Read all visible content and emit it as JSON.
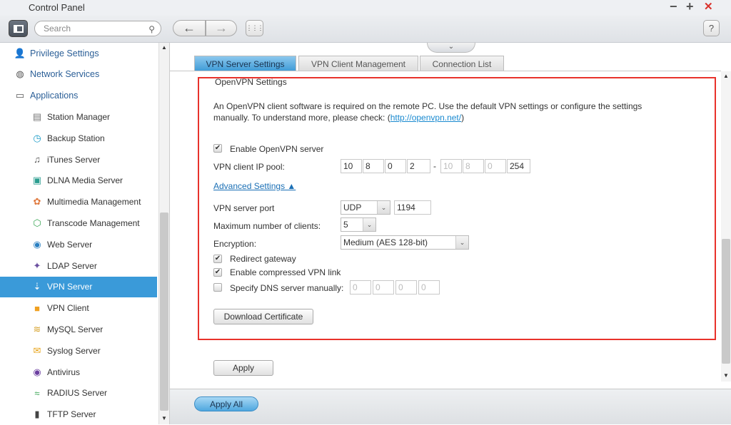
{
  "window": {
    "title": "Control Panel",
    "minimize": "−",
    "maximize": "+",
    "close": "✕"
  },
  "toolbar": {
    "search_placeholder": "Search",
    "back": "←",
    "forward": "→",
    "apps": "⋮⋮⋮",
    "help": "?"
  },
  "sidebar": {
    "items": [
      {
        "label": "Privilege Settings",
        "icon": "user-icon"
      },
      {
        "label": "Network Services",
        "icon": "globe-icon"
      },
      {
        "label": "Applications",
        "icon": "inbox-icon"
      },
      {
        "label": "Station Manager",
        "icon": "station-icon"
      },
      {
        "label": "Backup Station",
        "icon": "backup-icon"
      },
      {
        "label": "iTunes Server",
        "icon": "itunes-icon"
      },
      {
        "label": "DLNA Media Server",
        "icon": "dlna-icon"
      },
      {
        "label": "Multimedia Management",
        "icon": "multimedia-icon"
      },
      {
        "label": "Transcode Management",
        "icon": "transcode-icon"
      },
      {
        "label": "Web Server",
        "icon": "web-icon"
      },
      {
        "label": "LDAP Server",
        "icon": "ldap-icon"
      },
      {
        "label": "VPN Server",
        "icon": "vpn-server-icon",
        "selected": true
      },
      {
        "label": "VPN Client",
        "icon": "vpn-client-icon"
      },
      {
        "label": "MySQL Server",
        "icon": "mysql-icon"
      },
      {
        "label": "Syslog Server",
        "icon": "syslog-icon"
      },
      {
        "label": "Antivirus",
        "icon": "antivirus-icon"
      },
      {
        "label": "RADIUS Server",
        "icon": "radius-icon"
      },
      {
        "label": "TFTP Server",
        "icon": "tftp-icon"
      }
    ]
  },
  "tabs": [
    {
      "label": "VPN Server Settings",
      "active": true
    },
    {
      "label": "VPN Client Management"
    },
    {
      "label": "Connection List"
    }
  ],
  "openvpn": {
    "section_title": "OpenVPN Settings",
    "desc_line1": "An OpenVPN client software is required on the remote PC. Use the default VPN settings or configure the settings",
    "desc_line2": "manually. To understand more, please check: (",
    "link": "http://openvpn.net/",
    "desc_close": ")",
    "enable_label": "Enable OpenVPN server",
    "enable_checked": true,
    "ip_pool_label": "VPN client IP pool:",
    "ip_start": [
      "10",
      "8",
      "0",
      "2"
    ],
    "ip_end": [
      "10",
      "8",
      "0",
      "254"
    ],
    "dash": "-",
    "advanced": "Advanced Settings ▲",
    "port_label": "VPN server port",
    "protocol": "UDP",
    "port": "1194",
    "max_clients_label": "Maximum number of clients:",
    "max_clients": "5",
    "encryption_label": "Encryption:",
    "encryption": "Medium (AES 128-bit)",
    "redirect_label": "Redirect gateway",
    "redirect_checked": true,
    "compress_label": "Enable compressed VPN link",
    "compress_checked": true,
    "dns_label": "Specify DNS server manually:",
    "dns_checked": false,
    "dns": [
      "0",
      "0",
      "0",
      "0"
    ],
    "download_cert": "Download Certificate"
  },
  "apply": "Apply",
  "apply_all": "Apply All",
  "colors": {
    "highlight": "#3a9ad9",
    "annotation_box": "#e8322b",
    "link": "#1a8ad0"
  }
}
